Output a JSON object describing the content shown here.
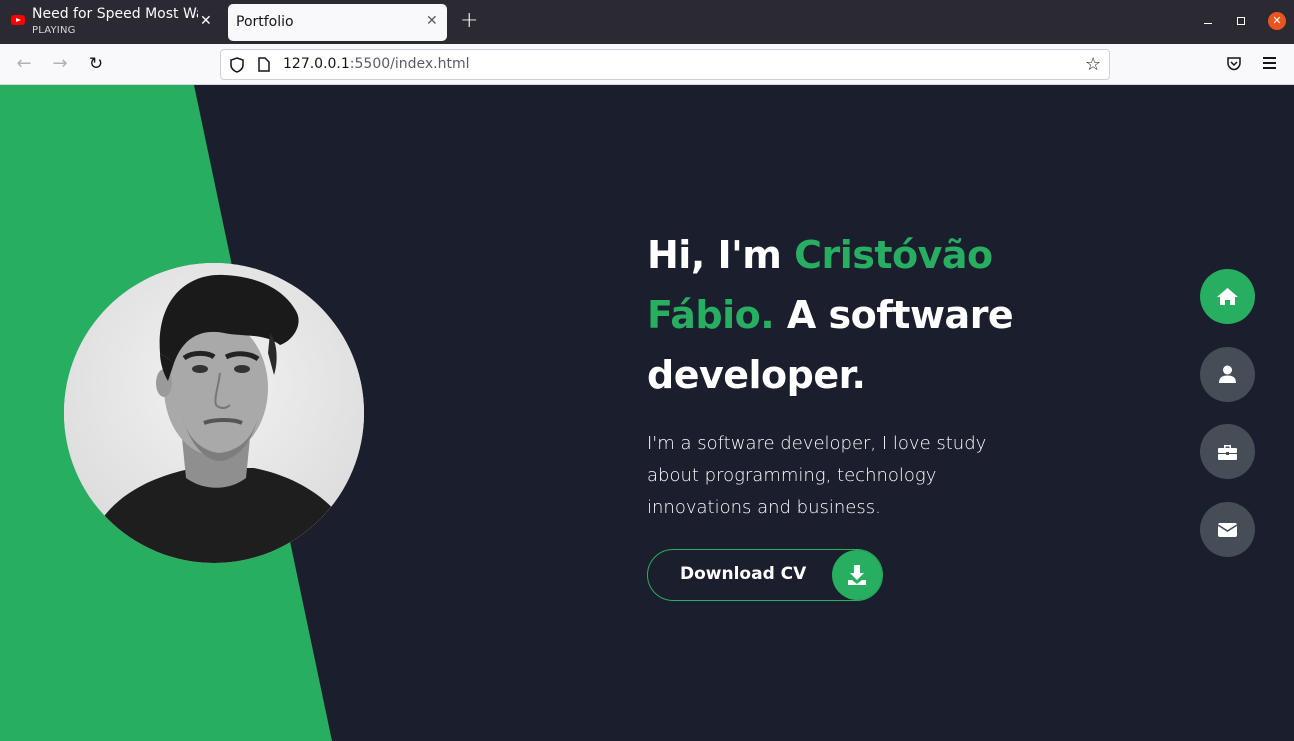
{
  "browser": {
    "tabs": [
      {
        "title": "Need for Speed Most Wanted",
        "status": "PLAYING",
        "active": false
      },
      {
        "title": "Portfolio",
        "active": true
      }
    ],
    "url": {
      "host": "127.0.0.1",
      "rest": ":5500/index.html"
    }
  },
  "hero": {
    "greeting": "Hi, I'm ",
    "name": "Cristóvão Fábio.",
    "tagline": " A software developer.",
    "description": "I'm a software developer, I love study about programming, technology innovations and business.",
    "cv_button": "Download CV"
  },
  "side_nav": [
    {
      "name": "home",
      "icon": "home-icon",
      "active": true
    },
    {
      "name": "about",
      "icon": "user-icon",
      "active": false
    },
    {
      "name": "portfolio",
      "icon": "briefcase-icon",
      "active": false
    },
    {
      "name": "contact",
      "icon": "envelope-icon",
      "active": false
    }
  ],
  "colors": {
    "accent": "#27ae60",
    "background": "#1b1e2c",
    "nav_inactive": "#454e56"
  }
}
